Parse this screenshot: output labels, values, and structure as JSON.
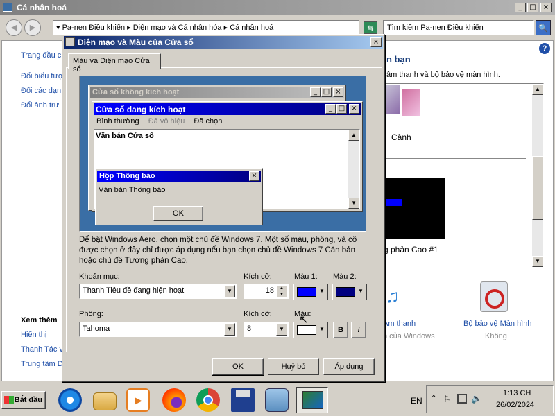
{
  "bg_window": {
    "title": "Cá nhân hoá",
    "breadcrumb": [
      "Pa-nen Điều khiển",
      "Diện mạo và Cá nhân hóa",
      "Cá nhân hoá"
    ],
    "search_placeholder": "Tìm kiếm Pa-nen Điều khiển",
    "sidebar_links": [
      "Trang đầu c",
      "Đổi biểu tượ",
      "Đổi các dạn",
      "Đổi ảnh trư"
    ],
    "see_also": "Xem thêm",
    "see_also_links": [
      "Hiển thị",
      "Thanh Tác v",
      "Trung tâm D"
    ],
    "right_heading": "n bạn",
    "right_text": "âm thanh và bộ bảo vệ màn hình.",
    "theme_label": "Cảnh",
    "theme2_label": "g phản Cao #1",
    "sound_label": "Âm thanh",
    "sound_sub": "h của Windows",
    "saver_label": "Bộ bảo vệ Màn hình",
    "saver_sub": "Không"
  },
  "dialog": {
    "title": "Diện mạo và Màu của Cửa sổ",
    "tab": "Màu và Diện mạo Cửa sổ",
    "inactive_title": "Cửa sổ không kích hoạt",
    "active_title": "Cửa sổ đang kích hoạt",
    "menu": [
      "Bình thường",
      "Đã vô hiệu",
      "Đã chọn"
    ],
    "window_text": "Văn bản Cửa sổ",
    "msg_title": "Hộp Thông báo",
    "msg_text": "Văn bản Thông báo",
    "ok": "OK",
    "description": "Để bật Windows Aero, chọn một chủ đề Windows 7.  Một số màu, phông, và cỡ được chọn ở đây chỉ được áp dụng nếu bạn chọn chủ đề Windows 7 Căn bản hoặc chủ đề Tương phản Cao.",
    "item_label": "Khoản mục:",
    "item_value": "Thanh Tiêu đề đang hiện hoạt",
    "size_label": "Kích cỡ:",
    "size_value": "18",
    "color1_label": "Màu 1:",
    "color2_label": "Màu 2:",
    "font_label": "Phông:",
    "font_value": "Tahoma",
    "font_size_label": "Kích cỡ:",
    "font_size_value": "8",
    "font_color_label": "Màu:",
    "bold": "B",
    "italic": "I",
    "btn_ok": "OK",
    "btn_cancel": "Huỷ bỏ",
    "btn_apply": "Áp dụng",
    "color1": "#0000ff",
    "color2": "#000080"
  },
  "taskbar": {
    "start": "Bắt đầu",
    "lang": "EN",
    "time": "1:13 CH",
    "date": "26/02/2024"
  }
}
